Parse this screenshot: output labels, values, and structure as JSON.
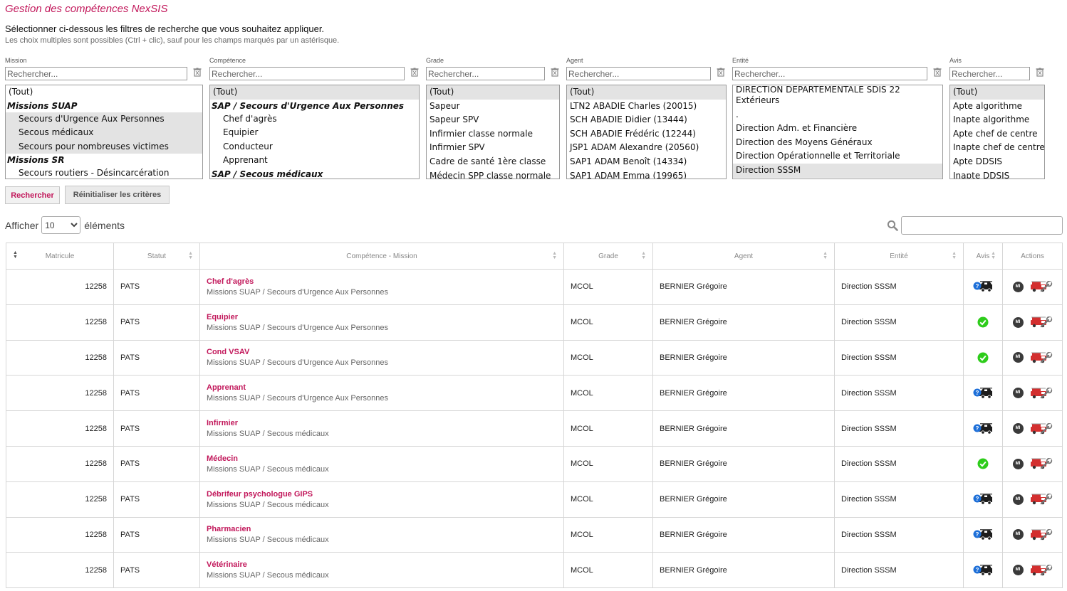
{
  "page": {
    "title": "Gestion des compétences NexSIS",
    "intro": "Sélectionner ci-dessous les filtres de recherche que vous souhaitez appliquer.",
    "hint": "Les choix multiples sont possibles (Ctrl + clic), sauf pour les champs marqués par un astérisque."
  },
  "filters": {
    "search_placeholder": "Rechercher...",
    "mission": {
      "label": "Mission",
      "options": [
        {
          "text": "(Tout)",
          "kind": "opt"
        },
        {
          "text": "Missions SUAP",
          "kind": "group"
        },
        {
          "text": "Secours d'Urgence Aux Personnes",
          "kind": "ind-sel"
        },
        {
          "text": "Secous médicaux",
          "kind": "ind-sel"
        },
        {
          "text": "Secours pour nombreuses victimes",
          "kind": "ind-sel"
        },
        {
          "text": "Missions SR",
          "kind": "group"
        },
        {
          "text": "Secours routiers - Désincarcération",
          "kind": "ind"
        }
      ]
    },
    "competence": {
      "label": "Compétence",
      "options": [
        {
          "text": "(Tout)",
          "kind": "sel"
        },
        {
          "text": "SAP / Secours d'Urgence Aux Personnes",
          "kind": "group"
        },
        {
          "text": "Chef d'agrès",
          "kind": "ind"
        },
        {
          "text": "Equipier",
          "kind": "ind"
        },
        {
          "text": "Conducteur",
          "kind": "ind"
        },
        {
          "text": "Apprenant",
          "kind": "ind"
        },
        {
          "text": "SAP / Secous médicaux",
          "kind": "group"
        }
      ]
    },
    "grade": {
      "label": "Grade",
      "options": [
        {
          "text": "(Tout)",
          "kind": "sel"
        },
        {
          "text": "Sapeur",
          "kind": "opt"
        },
        {
          "text": "Sapeur SPV",
          "kind": "opt"
        },
        {
          "text": "Infirmier classe normale",
          "kind": "opt"
        },
        {
          "text": "Infirmier SPV",
          "kind": "opt"
        },
        {
          "text": "Cadre de santé 1ère classe",
          "kind": "opt"
        },
        {
          "text": "Médecin SPP classe normale",
          "kind": "opt"
        }
      ]
    },
    "agent": {
      "label": "Agent",
      "options": [
        {
          "text": "(Tout)",
          "kind": "sel"
        },
        {
          "text": "LTN2 ABADIE Charles (20015)",
          "kind": "opt"
        },
        {
          "text": "SCH ABADIE Didier (13444)",
          "kind": "opt"
        },
        {
          "text": "SCH ABADIE Frédéric (12244)",
          "kind": "opt"
        },
        {
          "text": "JSP1 ADAM Alexandre (20560)",
          "kind": "opt"
        },
        {
          "text": "SAP1 ADAM Benoît (14334)",
          "kind": "opt"
        },
        {
          "text": "SAP1 ADAM Emma (19965)",
          "kind": "opt"
        }
      ]
    },
    "entite": {
      "label": "Entité",
      "options": [
        {
          "text": "DIRECTION DEPARTEMENTALE SDIS 22",
          "kind": "opt"
        },
        {
          "text": "Extérieurs",
          "kind": "opt"
        },
        {
          "text": ".",
          "kind": "opt"
        },
        {
          "text": "Direction Adm. et Financière",
          "kind": "opt"
        },
        {
          "text": "Direction des Moyens Généraux",
          "kind": "opt"
        },
        {
          "text": "Direction Opérationnelle et Territoriale",
          "kind": "opt"
        },
        {
          "text": "Direction SSSM",
          "kind": "sel"
        }
      ]
    },
    "avis": {
      "label": "Avis",
      "options": [
        {
          "text": "(Tout)",
          "kind": "sel"
        },
        {
          "text": "Apte algorithme",
          "kind": "opt"
        },
        {
          "text": "Inapte algorithme",
          "kind": "opt"
        },
        {
          "text": "Apte chef de centre",
          "kind": "opt"
        },
        {
          "text": "Inapte chef de centre",
          "kind": "opt"
        },
        {
          "text": "Apte DDSIS",
          "kind": "opt"
        },
        {
          "text": "Inapte DDSIS",
          "kind": "opt"
        }
      ]
    }
  },
  "buttons": {
    "search": "Rechercher",
    "reset": "Réinitialiser les critères"
  },
  "length": {
    "prefix": "Afficher",
    "value": "10",
    "options": [
      "10"
    ],
    "suffix": "éléments"
  },
  "colors": {
    "accent": "#c2185b",
    "approved": "#2ecc1b",
    "unknown": "#1d6fd8"
  },
  "table": {
    "headers": [
      "Matricule",
      "Statut",
      "Compétence - Mission",
      "Grade",
      "Agent",
      "Entité",
      "Avis",
      "Actions"
    ],
    "rows": [
      {
        "matricule": "12258",
        "statut": "PATS",
        "competence": "Chef d'agrès",
        "mission": "Missions SUAP / Secours d'Urgence Aux Personnes",
        "grade": "MCOL",
        "agent": "BERNIER Grégoire",
        "entite": "Direction SSSM",
        "avis": "pending",
        "mi": "MI"
      },
      {
        "matricule": "12258",
        "statut": "PATS",
        "competence": "Equipier",
        "mission": "Missions SUAP / Secours d'Urgence Aux Personnes",
        "grade": "MCOL",
        "agent": "BERNIER Grégoire",
        "entite": "Direction SSSM",
        "avis": "ok",
        "mi": "MI"
      },
      {
        "matricule": "12258",
        "statut": "PATS",
        "competence": "Cond VSAV",
        "mission": "Missions SUAP / Secours d'Urgence Aux Personnes",
        "grade": "MCOL",
        "agent": "BERNIER Grégoire",
        "entite": "Direction SSSM",
        "avis": "ok",
        "mi": "MI"
      },
      {
        "matricule": "12258",
        "statut": "PATS",
        "competence": "Apprenant",
        "mission": "Missions SUAP / Secours d'Urgence Aux Personnes",
        "grade": "MCOL",
        "agent": "BERNIER Grégoire",
        "entite": "Direction SSSM",
        "avis": "pending",
        "mi": "MI"
      },
      {
        "matricule": "12258",
        "statut": "PATS",
        "competence": "Infirmier",
        "mission": "Missions SUAP / Secous médicaux",
        "grade": "MCOL",
        "agent": "BERNIER Grégoire",
        "entite": "Direction SSSM",
        "avis": "pending",
        "mi": "MI"
      },
      {
        "matricule": "12258",
        "statut": "PATS",
        "competence": "Médecin",
        "mission": "Missions SUAP / Secous médicaux",
        "grade": "MCOL",
        "agent": "BERNIER Grégoire",
        "entite": "Direction SSSM",
        "avis": "ok",
        "mi": "MI"
      },
      {
        "matricule": "12258",
        "statut": "PATS",
        "competence": "Débrifeur psychologue GIPS",
        "mission": "Missions SUAP / Secous médicaux",
        "grade": "MCOL",
        "agent": "BERNIER Grégoire",
        "entite": "Direction SSSM",
        "avis": "pending",
        "mi": "MI"
      },
      {
        "matricule": "12258",
        "statut": "PATS",
        "competence": "Pharmacien",
        "mission": "Missions SUAP / Secous médicaux",
        "grade": "MCOL",
        "agent": "BERNIER Grégoire",
        "entite": "Direction SSSM",
        "avis": "pending",
        "mi": "MI"
      },
      {
        "matricule": "12258",
        "statut": "PATS",
        "competence": "Vétérinaire",
        "mission": "Missions SUAP / Secous médicaux",
        "grade": "MCOL",
        "agent": "BERNIER Grégoire",
        "entite": "Direction SSSM",
        "avis": "pending",
        "mi": "MI"
      }
    ]
  }
}
